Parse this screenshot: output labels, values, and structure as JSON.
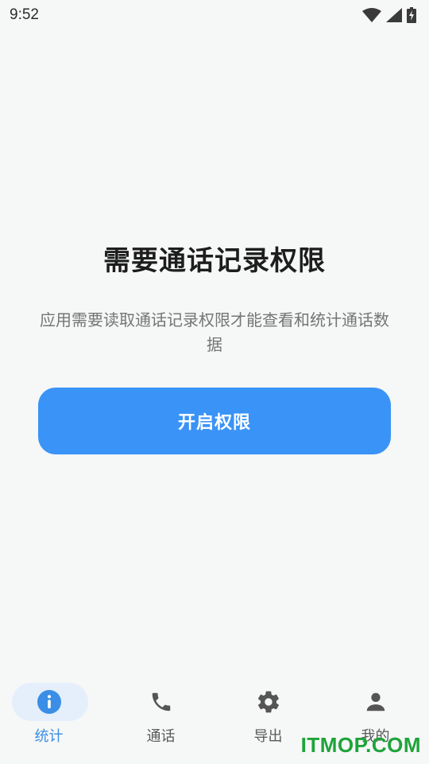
{
  "status_bar": {
    "time": "9:52",
    "icons": [
      "wifi-icon",
      "signal-icon",
      "battery-charging-icon"
    ]
  },
  "main": {
    "title": "需要通话记录权限",
    "description": "应用需要读取通话记录权限才能查看和统计通话数据",
    "button_label": "开启权限"
  },
  "bottom_nav": {
    "items": [
      {
        "label": "统计",
        "icon": "info-icon",
        "active": true
      },
      {
        "label": "通话",
        "icon": "phone-icon",
        "active": false
      },
      {
        "label": "导出",
        "icon": "gear-icon",
        "active": false
      },
      {
        "label": "我的",
        "icon": "person-icon",
        "active": false
      }
    ]
  },
  "watermark": "ITMOP.COM",
  "colors": {
    "accent": "#3a93f7",
    "active_nav": "#3a8ee6",
    "background": "#f6f7f7",
    "watermark": "#1ea43a"
  }
}
